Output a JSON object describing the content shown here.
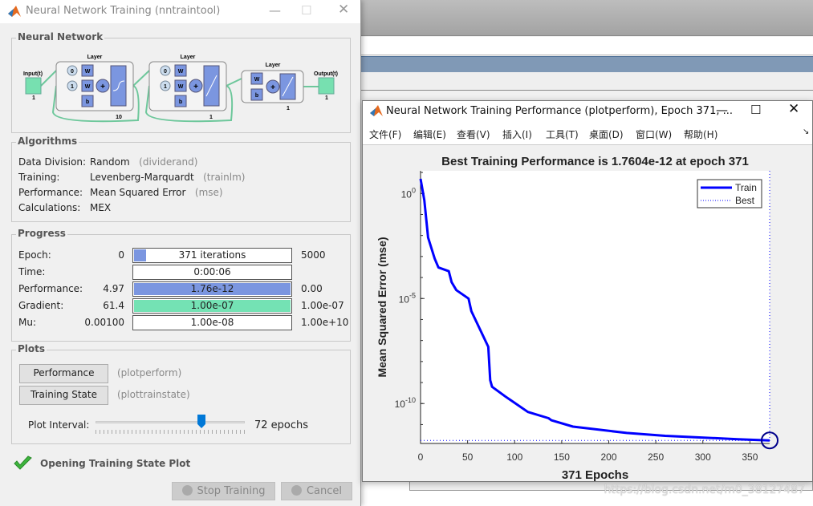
{
  "left_window": {
    "title": "Neural Network Training (nntraintool)",
    "network": {
      "legend": "Neural Network",
      "input_label": "Input(t)",
      "input_size": "1",
      "output_label": "Output(t)",
      "output_size": "1",
      "layers": [
        {
          "label": "Layer",
          "size": "10",
          "delays": [
            "0",
            "1"
          ],
          "weight": "W",
          "bias": "b",
          "transfer": "tansig"
        },
        {
          "label": "Layer",
          "size": "1",
          "delays": [
            "0",
            "1"
          ],
          "weight": "W",
          "bias": "b",
          "transfer": "purelin"
        },
        {
          "label": "Layer",
          "size": "1",
          "weight": "W",
          "bias": "b",
          "transfer": "purelin"
        }
      ]
    },
    "algorithms": {
      "legend": "Algorithms",
      "rows": [
        {
          "label": "Data Division:",
          "value": "Random",
          "fn": "(dividerand)"
        },
        {
          "label": "Training:",
          "value": "Levenberg-Marquardt",
          "fn": "(trainlm)"
        },
        {
          "label": "Performance:",
          "value": "Mean Squared Error",
          "fn": "(mse)"
        },
        {
          "label": "Calculations:",
          "value": "MEX",
          "fn": ""
        }
      ]
    },
    "progress": {
      "legend": "Progress",
      "rows": [
        {
          "label": "Epoch:",
          "start": "0",
          "bar": "371 iterations",
          "end": "5000",
          "fill": 0.074,
          "color": "#7b96e0"
        },
        {
          "label": "Time:",
          "start": "",
          "bar": "0:00:06",
          "end": "",
          "fill": 0,
          "color": "#7b96e0"
        },
        {
          "label": "Performance:",
          "start": "4.97",
          "bar": "1.76e-12",
          "end": "0.00",
          "fill": 0.99,
          "color": "#7b96e0"
        },
        {
          "label": "Gradient:",
          "start": "61.4",
          "bar": "1.00e-07",
          "end": "1.00e-07",
          "fill": 0.99,
          "color": "#74e2b4"
        },
        {
          "label": "Mu:",
          "start": "0.00100",
          "bar": "1.00e-08",
          "end": "1.00e+10",
          "fill": 0,
          "color": "#7b96e0"
        }
      ]
    },
    "plots": {
      "legend": "Plots",
      "buttons": [
        {
          "label": "Performance",
          "fn": "(plotperform)"
        },
        {
          "label": "Training State",
          "fn": "(plottrainstate)"
        }
      ],
      "interval_label": "Plot Interval:",
      "interval_value": "72 epochs",
      "slider_fraction": 0.71
    },
    "status": "Opening Training State Plot",
    "stop_label": "Stop Training",
    "cancel_label": "Cancel"
  },
  "right_window": {
    "title": "Neural Network Training Performance (plotperform), Epoch 371, ...",
    "menu": [
      "文件(F)",
      "编辑(E)",
      "查看(V)",
      "插入(I)",
      "工具(T)",
      "桌面(D)",
      "窗口(W)",
      "帮助(H)"
    ]
  },
  "chart_data": {
    "type": "line",
    "title": "Best Training Performance is 1.7604e-12 at epoch 371",
    "xlabel": "371 Epochs",
    "ylabel": "Mean Squared Error  (mse)",
    "xlim": [
      0,
      371
    ],
    "ylim": [
      1.26e-12,
      12
    ],
    "yscale": "log",
    "xticks": [
      0,
      50,
      100,
      150,
      200,
      250,
      300,
      350
    ],
    "yticks": [
      {
        "value": 1,
        "label": "10",
        "exp": "0"
      },
      {
        "value": 1e-05,
        "label": "10",
        "exp": "-5"
      },
      {
        "value": 1e-10,
        "label": "10",
        "exp": "-10"
      }
    ],
    "legend": {
      "position": "top-right",
      "entries": [
        "Train",
        "Best"
      ]
    },
    "series": [
      {
        "name": "Train",
        "color": "#0000ff",
        "x": [
          0,
          4,
          8,
          15,
          19,
          30,
          33,
          38,
          51,
          54,
          72,
          74,
          76,
          90,
          114,
          136,
          139,
          162,
          219,
          260,
          337,
          371
        ],
        "y": [
          4.97,
          0.48,
          0.008,
          0.0008,
          0.0003,
          0.0002,
          6e-05,
          2.5e-05,
          1e-05,
          2.5e-06,
          5e-08,
          1.3e-09,
          6.3e-10,
          2.2e-10,
          4e-11,
          2e-11,
          1.6e-11,
          8e-12,
          4e-12,
          2.9e-12,
          2e-12,
          1.7604e-12
        ]
      }
    ],
    "best": {
      "name": "Best",
      "epoch": 371,
      "value": 1.7604e-12,
      "color": "#0000ff"
    }
  },
  "watermark": "https://blog.csdn.net/m0_38127487"
}
